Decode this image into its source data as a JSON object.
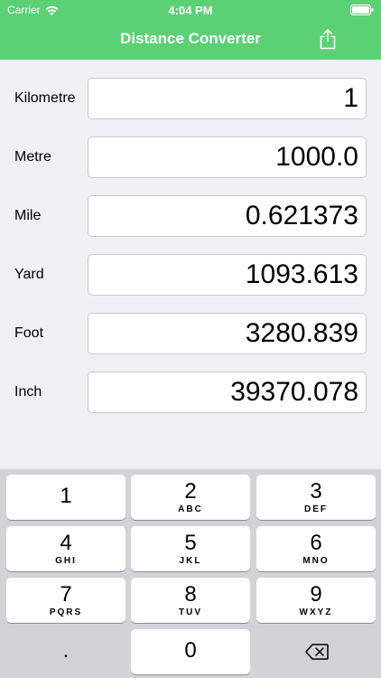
{
  "status_bar": {
    "carrier": "Carrier",
    "time": "4:04 PM",
    "wifi_icon": "wifi-icon",
    "battery_icon": "battery-icon"
  },
  "nav": {
    "title": "Distance Converter",
    "share_icon": "share-icon"
  },
  "rows": [
    {
      "label": "Kilometre",
      "value": "1"
    },
    {
      "label": "Metre",
      "value": "1000.0"
    },
    {
      "label": "Mile",
      "value": "0.621373"
    },
    {
      "label": "Yard",
      "value": "1093.613"
    },
    {
      "label": "Foot",
      "value": "3280.839"
    },
    {
      "label": "Inch",
      "value": "39370.078"
    }
  ],
  "keypad": {
    "keys": [
      {
        "digit": "1",
        "letters": ""
      },
      {
        "digit": "2",
        "letters": "ABC"
      },
      {
        "digit": "3",
        "letters": "DEF"
      },
      {
        "digit": "4",
        "letters": "GHI"
      },
      {
        "digit": "5",
        "letters": "JKL"
      },
      {
        "digit": "6",
        "letters": "MNO"
      },
      {
        "digit": "7",
        "letters": "PQRS"
      },
      {
        "digit": "8",
        "letters": "TUV"
      },
      {
        "digit": "9",
        "letters": "WXYZ"
      }
    ],
    "decimal": ".",
    "zero": "0",
    "delete_icon": "delete-backspace-icon"
  },
  "colors": {
    "accent": "#5bd075",
    "background": "#efeff4",
    "keypad_background": "#d1d3d9"
  }
}
